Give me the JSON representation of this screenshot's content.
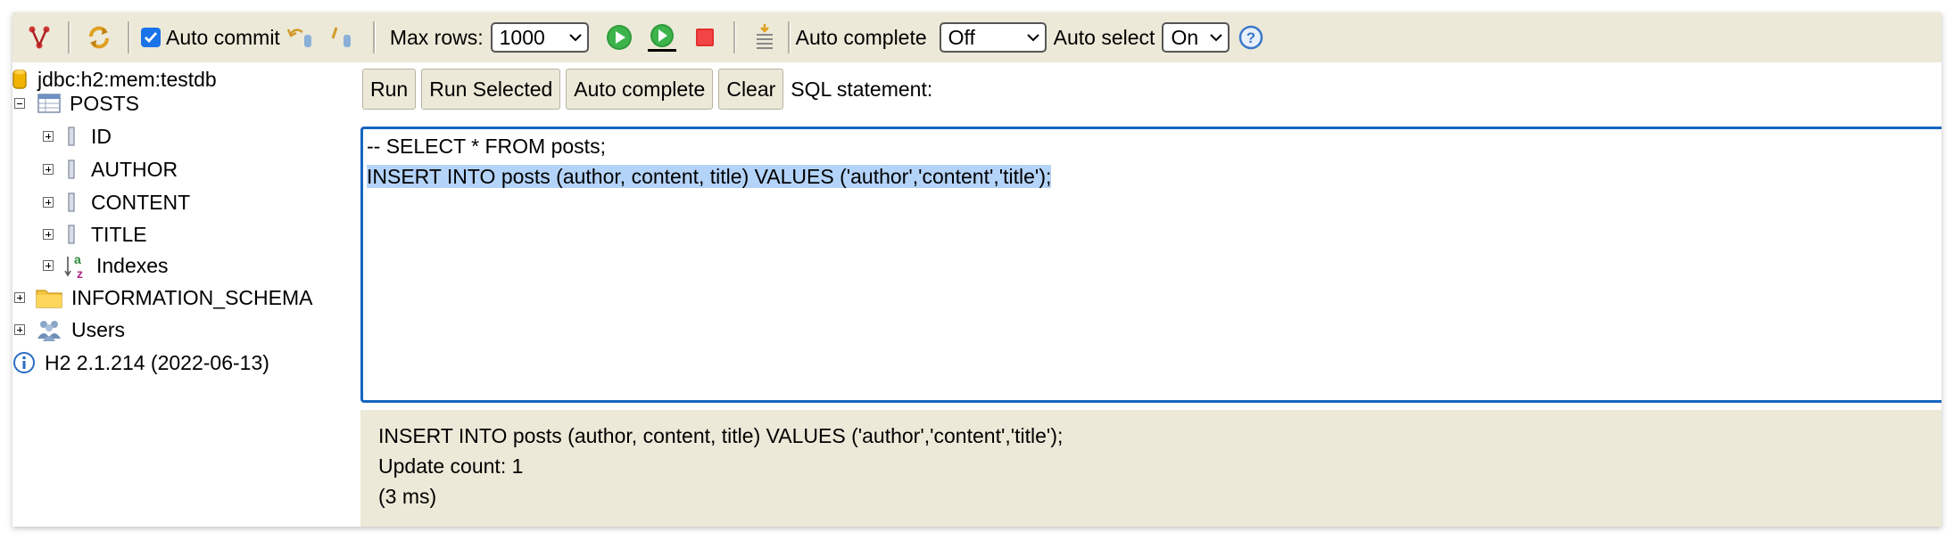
{
  "toolbar": {
    "auto_commit_label": "Auto commit",
    "auto_commit_checked": true,
    "max_rows_label": "Max rows:",
    "max_rows_value": "1000",
    "auto_complete_label": "Auto complete",
    "auto_complete_value": "Off",
    "auto_select_label": "Auto select",
    "auto_select_value": "On",
    "icons": [
      "disconnect-icon",
      "refresh-icon",
      "rollback-icon",
      "commit-icon",
      "run-icon",
      "run-selected-icon",
      "stop-icon",
      "history-icon",
      "help-icon"
    ]
  },
  "tree": {
    "connection": "jdbc:h2:mem:testdb",
    "table": "POSTS",
    "columns": [
      "ID",
      "AUTHOR",
      "CONTENT",
      "TITLE"
    ],
    "indexes": "Indexes",
    "schema": "INFORMATION_SCHEMA",
    "users": "Users",
    "version": "H2 2.1.214 (2022-06-13)"
  },
  "buttons": {
    "run": "Run",
    "run_selected": "Run Selected",
    "auto_complete": "Auto complete",
    "clear": "Clear",
    "sql_statement": "SQL statement:"
  },
  "editor": {
    "line1": "-- SELECT * FROM posts;",
    "line2": "INSERT INTO posts (author, content, title) VALUES ('author','content','title');"
  },
  "result": {
    "statement": "INSERT INTO posts (author, content, title) VALUES ('author','content','title');",
    "update_count": "Update count: 1",
    "time": "(3 ms)"
  },
  "colors": {
    "toolbar_bg": "#ece9d8",
    "editor_border": "#1565c0",
    "selection": "#b4d3f8"
  }
}
